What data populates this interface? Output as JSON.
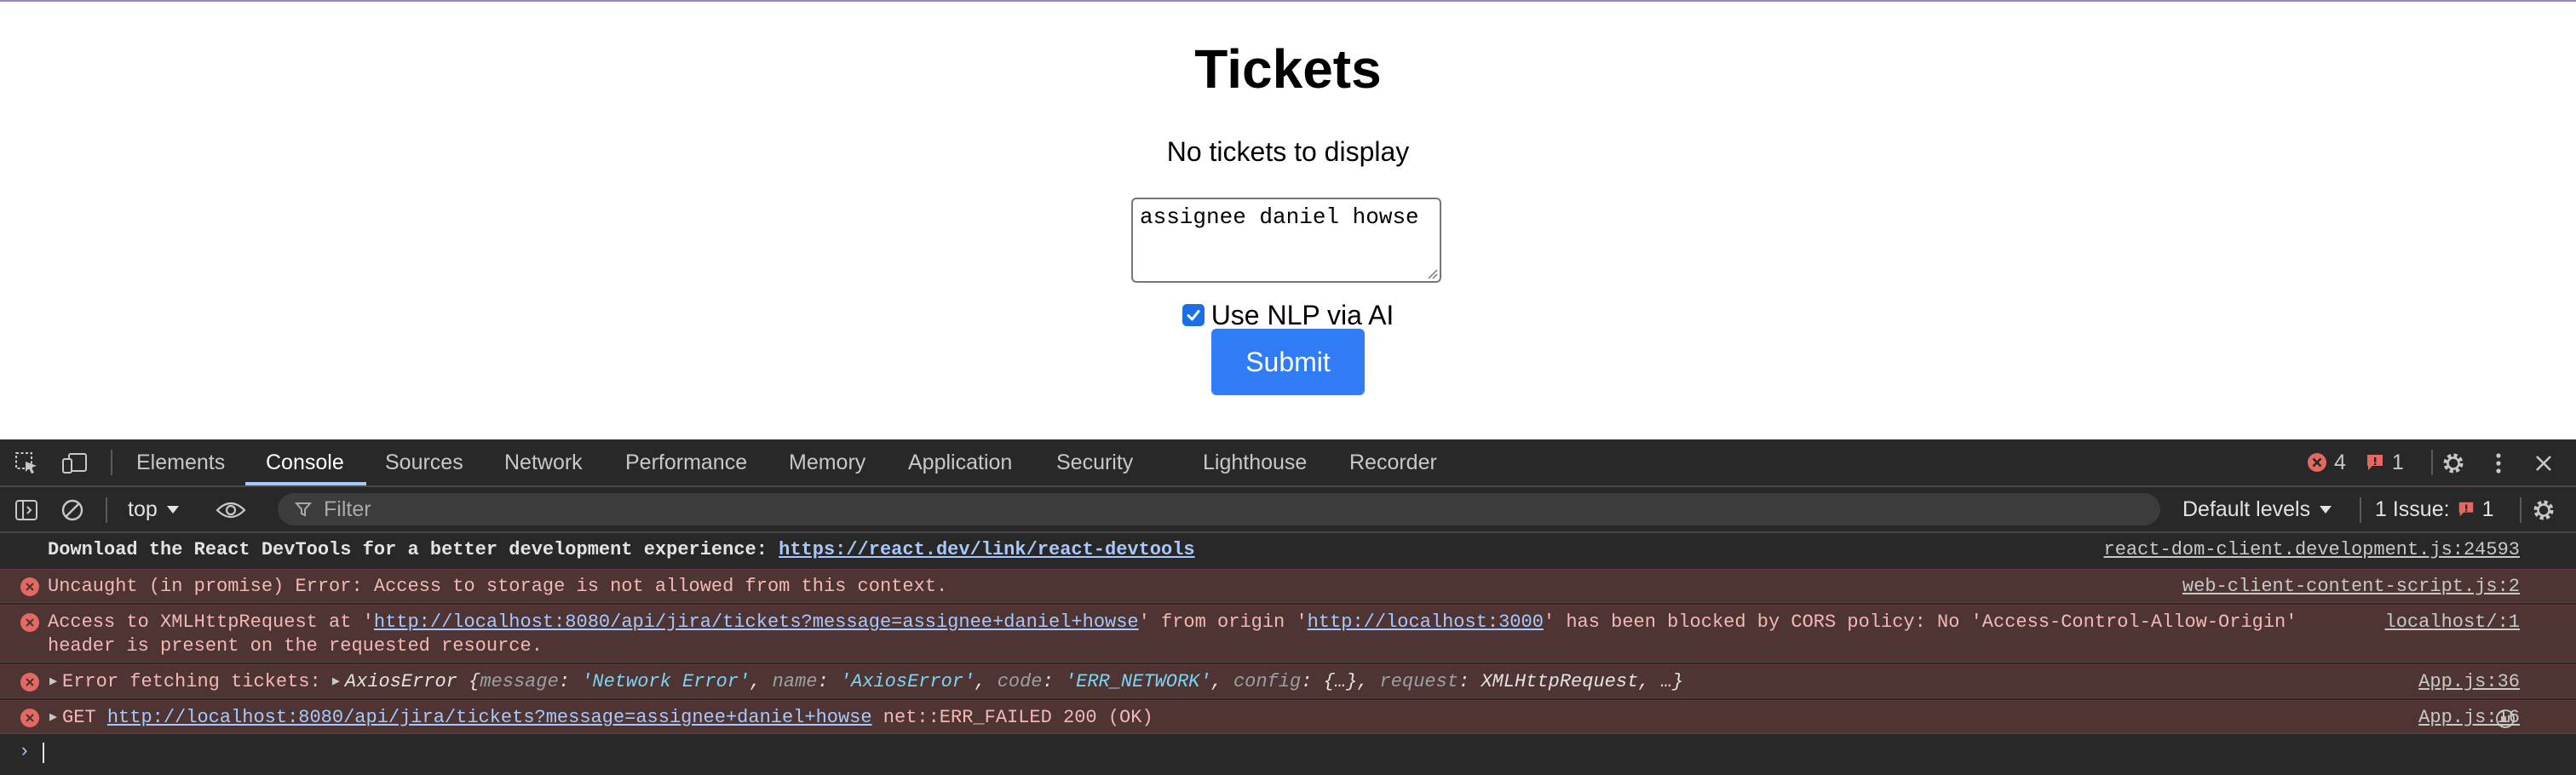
{
  "page": {
    "title": "Tickets",
    "empty_message": "No tickets to display",
    "query_value": "assignee daniel howse",
    "nlp_label": "Use NLP via AI",
    "nlp_checked": true,
    "submit_label": "Submit"
  },
  "devtools": {
    "tabs": [
      {
        "label": "Elements"
      },
      {
        "label": "Console"
      },
      {
        "label": "Sources"
      },
      {
        "label": "Network"
      },
      {
        "label": "Performance"
      },
      {
        "label": "Memory"
      },
      {
        "label": "Application"
      },
      {
        "label": "Security"
      },
      {
        "label": "Lighthouse"
      },
      {
        "label": "Recorder"
      }
    ],
    "active_tab": "Console",
    "error_count": "4",
    "issue_count": "1",
    "toolbar": {
      "context": "top",
      "filter_placeholder": "Filter",
      "levels_label": "Default levels",
      "issues_label": "1 Issue:",
      "issues_count": "1"
    },
    "console": {
      "rows": [
        {
          "text": "Download the React DevTools for a better development experience: ",
          "link": "https://react.dev/link/react-devtools",
          "source": "react-dom-client.development.js:24593"
        },
        {
          "text": "Uncaught (in promise) Error: Access to storage is not allowed from this context.",
          "source": "web-client-content-script.js:2"
        },
        {
          "t1": "Access to XMLHttpRequest at '",
          "link1": "http://localhost:8080/api/jira/tickets?message=assignee+daniel+howse",
          "t2": "' from origin '",
          "link2": "http://localhost:3000",
          "t3": "' has been blocked by CORS policy: No 'Access-Control-Allow-Origin'",
          "t4": "header is present on the requested resource.",
          "source": "localhost/:1"
        },
        {
          "prefix": "Error fetching tickets: ",
          "cls": "AxiosError",
          "brace_open": "{",
          "k1": "message",
          "v1": "'Network Error'",
          "k2": "name",
          "v2": "'AxiosError'",
          "k3": "code",
          "v3": "'ERR_NETWORK'",
          "k4": "config",
          "v4": "{…}",
          "k5": "request",
          "v5": "XMLHttpRequest",
          "tail": "…}",
          "source": "App.js:36"
        },
        {
          "method": "GET ",
          "link": "http://localhost:8080/api/jira/tickets?message=assignee+daniel+howse",
          "status": " net::ERR_FAILED 200 (OK)",
          "source": "App.js:16"
        }
      ]
    },
    "colors": {
      "accent": "#a8c7fa",
      "error_bg": "#4e3534",
      "error_icon": "#e46962",
      "submit_bg": "#2f7cf6"
    }
  }
}
